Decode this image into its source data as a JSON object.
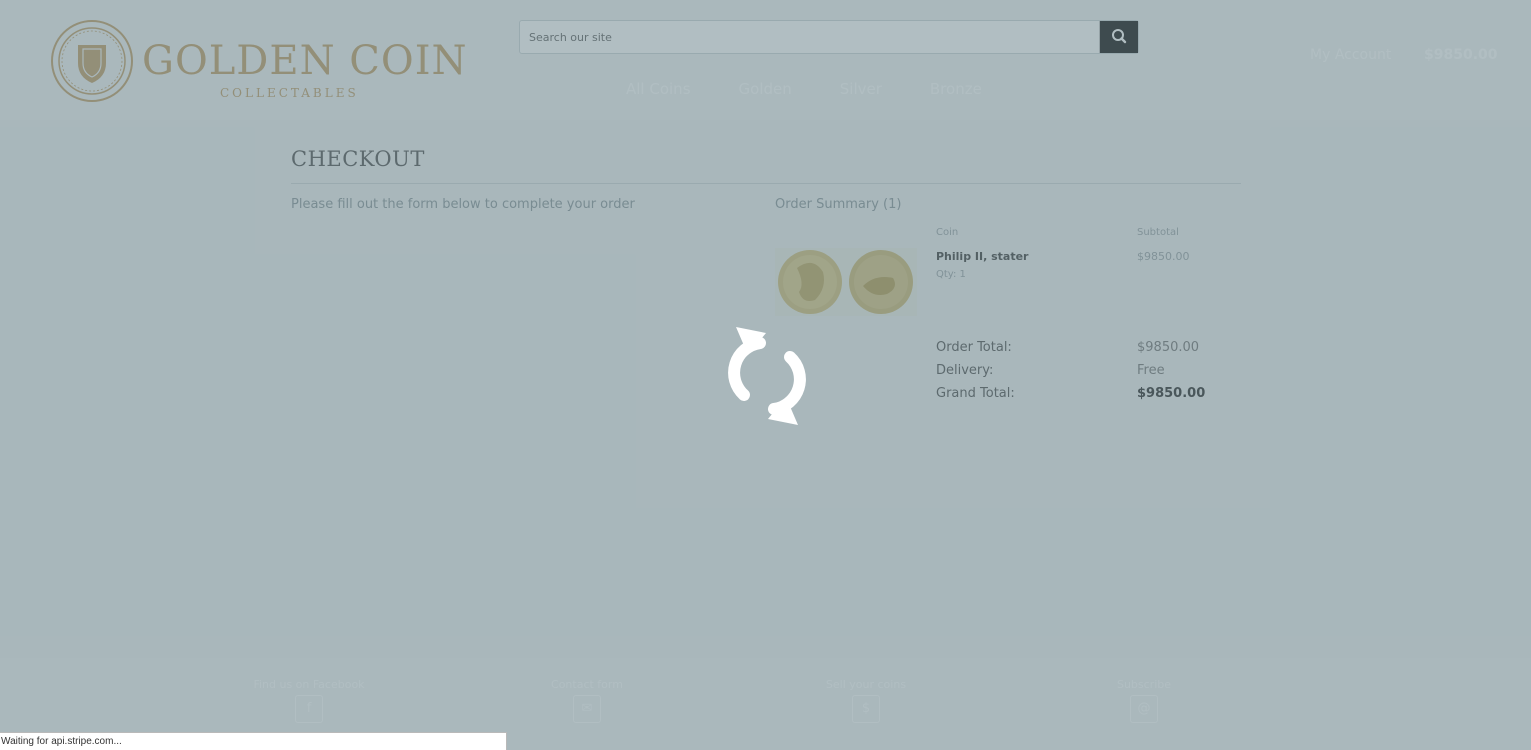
{
  "brand": {
    "name": "GOLDEN COIN",
    "tagline": "COLLECTABLES",
    "color": "#c8a979"
  },
  "search": {
    "placeholder": "Search our site",
    "button_icon": "search-icon"
  },
  "nav": {
    "items": [
      "All Coins",
      "Golden",
      "Silver",
      "Bronze"
    ]
  },
  "account": {
    "label": "My Account",
    "cart_total": "$9850.00"
  },
  "checkout": {
    "title": "CHECKOUT",
    "form_intro": "Please fill out the form below to complete your order"
  },
  "summary": {
    "title": "Order Summary (1)",
    "columns": {
      "coin": "Coin",
      "subtotal": "Subtotal"
    },
    "items": [
      {
        "name": "Philip II, stater",
        "qty": "Qty: 1",
        "subtotal": "$9850.00"
      }
    ],
    "totals": {
      "order_total_label": "Order Total:",
      "order_total_value": "$9850.00",
      "delivery_label": "Delivery:",
      "delivery_value": "Free",
      "grand_total_label": "Grand Total:",
      "grand_total_value": "$9850.00"
    }
  },
  "footer": {
    "facebook": {
      "label": "Find us on Facebook",
      "icon": "facebook-icon"
    },
    "contact": {
      "label": "Contact form",
      "icon": "envelope-icon"
    },
    "sell": {
      "label": "Sell your coins",
      "icon": "dollar-icon"
    },
    "subscribe": {
      "label": "Subscribe",
      "icon": "at-icon"
    }
  },
  "overlay": {
    "spinner_icon": "refresh-icon",
    "status_text": "Waiting for api.stripe.com..."
  },
  "colors": {
    "header_bg": "#f2f4f5",
    "overlay": "#516f77",
    "accent_gold": "#c8a979",
    "search_button": "#2f2f2f"
  }
}
